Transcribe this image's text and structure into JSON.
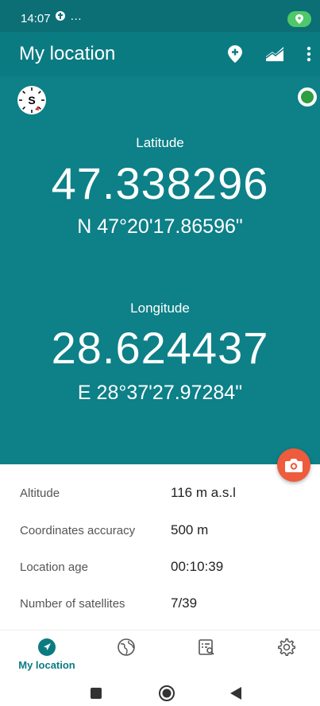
{
  "status_bar": {
    "time": "14:07",
    "extra": "…"
  },
  "app_bar": {
    "title": "My location",
    "add_place_icon": "add-location-icon",
    "altitude_icon": "terrain-icon",
    "menu_icon": "more-vert-icon"
  },
  "compass": {
    "letter": "S"
  },
  "latitude": {
    "label": "Latitude",
    "decimal": "47.338296",
    "dms": "N 47°20'17.86596\""
  },
  "longitude": {
    "label": "Longitude",
    "decimal": "28.624437",
    "dms": "E 28°37'27.97284\""
  },
  "details": [
    {
      "label": "Altitude",
      "value": "116 m a.s.l"
    },
    {
      "label": "Coordinates accuracy",
      "value": "500 m"
    },
    {
      "label": "Location age",
      "value": "00:10:39"
    },
    {
      "label": "Number of satellites",
      "value": "7/39"
    }
  ],
  "bottom_nav": {
    "items": [
      {
        "label": "My location",
        "icon": "navigation-arrow-icon",
        "active": true
      },
      {
        "label": "",
        "icon": "globe-icon",
        "active": false
      },
      {
        "label": "",
        "icon": "list-search-icon",
        "active": false
      },
      {
        "label": "",
        "icon": "settings-icon",
        "active": false
      }
    ]
  },
  "colors": {
    "primary": "#0d8088",
    "app_bar": "#0b7b82",
    "accent": "#ee5b3d",
    "gps_ok": "#2e9e43"
  }
}
